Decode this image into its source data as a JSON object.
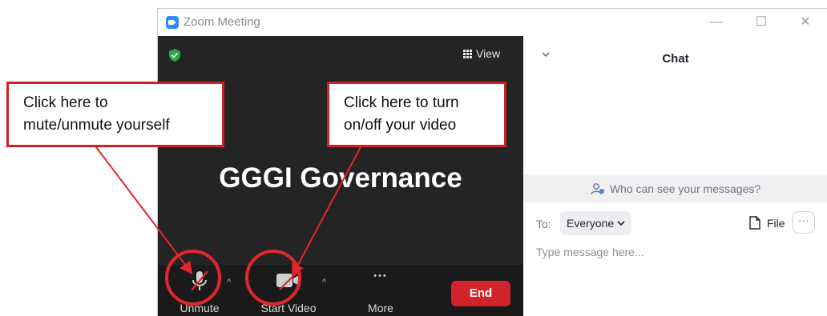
{
  "window": {
    "title": "Zoom Meeting",
    "controls": {
      "minimize": "—",
      "maximize": "☐",
      "close": "✕"
    }
  },
  "video": {
    "view_label": "View",
    "participant_name": "GGGI Governance",
    "security_color": "#2aa745"
  },
  "toolbar": {
    "unmute_label": "Unmute",
    "start_video_label": "Start Video",
    "more_label": "More",
    "more_glyph": "•••",
    "caret": "^",
    "end_label": "End",
    "end_color": "#d3242c"
  },
  "chat": {
    "title": "Chat",
    "privacy_text": "Who can see your messages?",
    "to_label": "To:",
    "recipient": "Everyone",
    "file_label": "File",
    "more_glyph": "···",
    "input_placeholder": "Type message here..."
  },
  "annotations": {
    "mute_callout": [
      "Click here to",
      "mute/unmute yourself"
    ],
    "video_callout": [
      "Click here to turn",
      "on/off your video"
    ],
    "accent_color": "#e3262d"
  },
  "icons": [
    "zoom-app-icon",
    "shield-check-icon",
    "grid-view-icon",
    "muted-mic-icon",
    "video-off-icon",
    "chevron-down-icon",
    "person-icon",
    "file-icon",
    "more-icon"
  ]
}
